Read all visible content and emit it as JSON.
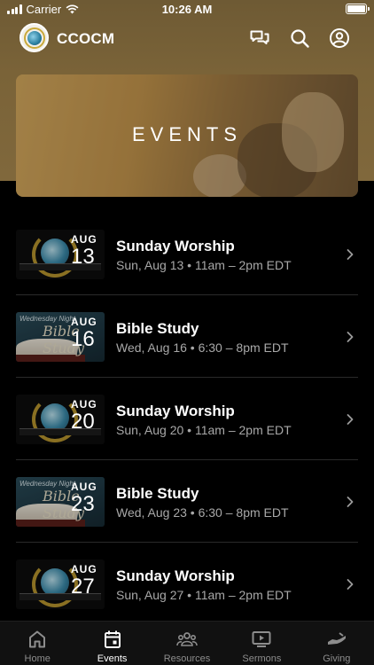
{
  "status_bar": {
    "carrier": "Carrier",
    "time": "10:26 AM"
  },
  "header": {
    "app_title": "CCOCM"
  },
  "banner": {
    "title": "EVENTS"
  },
  "events": [
    {
      "title": "Sunday Worship",
      "meta": "Sun, Aug 13 • 11am – 2pm EDT",
      "month": "AUG",
      "day": "13",
      "thumb": "worship"
    },
    {
      "title": "Bible Study",
      "meta": "Wed, Aug 16 • 6:30 – 8pm EDT",
      "month": "AUG",
      "day": "16",
      "thumb": "study",
      "thumb_caption": "Wednesday Night",
      "thumb_script": "Bible Study"
    },
    {
      "title": "Sunday Worship",
      "meta": "Sun, Aug 20 • 11am – 2pm EDT",
      "month": "AUG",
      "day": "20",
      "thumb": "worship"
    },
    {
      "title": "Bible Study",
      "meta": "Wed, Aug 23 • 6:30 – 8pm EDT",
      "month": "AUG",
      "day": "23",
      "thumb": "study",
      "thumb_caption": "Wednesday Night",
      "thumb_script": "Bible Study"
    },
    {
      "title": "Sunday Worship",
      "meta": "Sun, Aug 27 • 11am – 2pm EDT",
      "month": "AUG",
      "day": "27",
      "thumb": "worship"
    }
  ],
  "tabs": [
    {
      "label": "Home",
      "icon": "home-icon",
      "active": false
    },
    {
      "label": "Events",
      "icon": "calendar-icon",
      "active": true
    },
    {
      "label": "Resources",
      "icon": "people-icon",
      "active": false
    },
    {
      "label": "Sermons",
      "icon": "video-icon",
      "active": false
    },
    {
      "label": "Giving",
      "icon": "giving-hand-icon",
      "active": false
    }
  ],
  "colors": {
    "header_bg": "#7a6338",
    "background": "#000000",
    "meta_text": "#a8a8a8",
    "tab_inactive": "#8d8d8d",
    "accent_active": "#ffffff"
  }
}
